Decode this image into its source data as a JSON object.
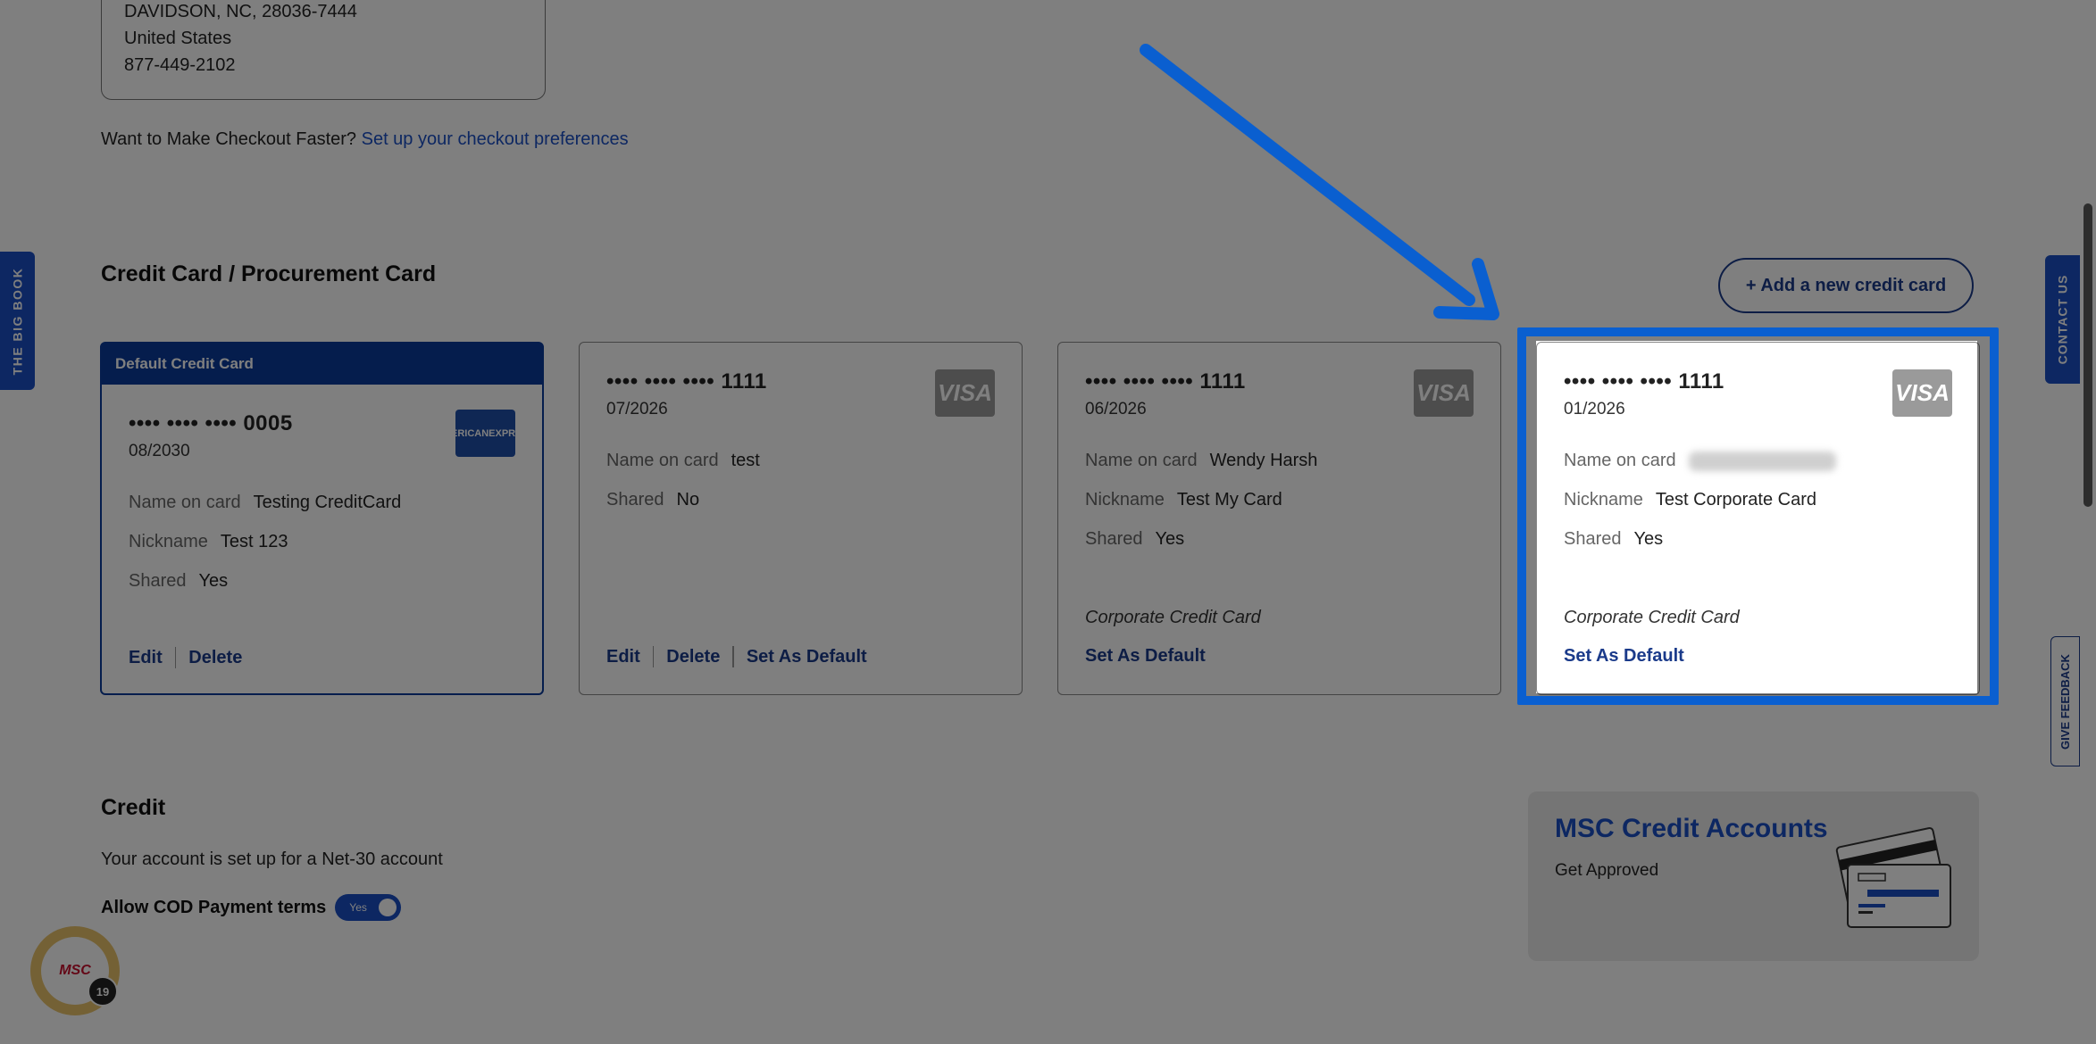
{
  "address": {
    "lines": [
      "DAVIDSON, NC, 28036-7444",
      "United States",
      "877-449-2102"
    ]
  },
  "checkout": {
    "prompt": "Want to Make Checkout Faster?",
    "link": "Set up your checkout preferences"
  },
  "cards_section": {
    "title": "Credit Card / Procurement Card",
    "add_button": "+ Add a new credit card",
    "labels": {
      "name_on_card": "Name on card",
      "nickname": "Nickname",
      "shared": "Shared"
    },
    "cards": [
      {
        "header": "Default Credit Card",
        "number": "•••• •••• •••• 0005",
        "expiry": "08/2030",
        "brand": "AMERICAN EXPRESS",
        "name_on_card": "Testing CreditCard",
        "nickname": "Test 123",
        "shared": "Yes",
        "actions": [
          "Edit",
          "Delete"
        ]
      },
      {
        "number": "•••• •••• •••• 1111",
        "expiry": "07/2026",
        "brand": "VISA",
        "name_on_card": "test",
        "shared": "No",
        "actions": [
          "Edit",
          "Delete",
          "Set As Default"
        ]
      },
      {
        "number": "•••• •••• •••• 1111",
        "expiry": "06/2026",
        "brand": "VISA",
        "name_on_card": "Wendy Harsh",
        "nickname": "Test My Card",
        "shared": "Yes",
        "type": "Corporate Credit Card",
        "actions": [
          "Set As Default"
        ]
      },
      {
        "number": "•••• •••• •••• 1111",
        "expiry": "01/2026",
        "brand": "VISA",
        "nickname": "Test Corporate Card",
        "shared": "Yes",
        "type": "Corporate Credit Card",
        "actions": [
          "Set As Default"
        ]
      }
    ]
  },
  "credit": {
    "title": "Credit",
    "net_terms": "Your account is set up for a Net-30 account",
    "cod_label": "Allow COD Payment terms",
    "cod_toggle": "Yes",
    "promo_title": "MSC Credit Accounts",
    "promo_sub": "Get Approved"
  },
  "side_tabs": {
    "big_book": "THE BIG BOOK",
    "contact": "CONTACT US",
    "feedback": "GIVE FEEDBACK"
  },
  "badge": {
    "logo": "MSC",
    "count": "19"
  },
  "colors": {
    "accent": "#1a4fc4",
    "navy": "#0a3a9a",
    "highlight": "#0a5fd0",
    "overlay": "rgba(0,0,0,0.5)"
  }
}
